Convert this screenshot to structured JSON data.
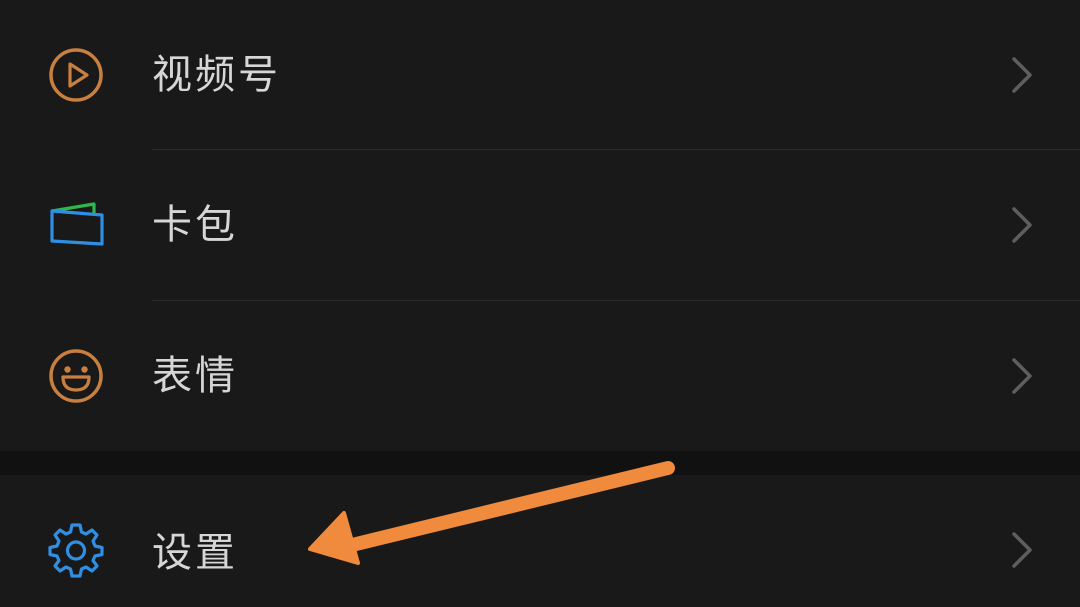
{
  "menu": {
    "items": [
      {
        "label": "视频号",
        "icon": "video-channel-icon",
        "icon_color": "#c97f3f"
      },
      {
        "label": "卡包",
        "icon": "card-wallet-icon",
        "icon_color": "#2f8fe3"
      },
      {
        "label": "表情",
        "icon": "emoji-smile-icon",
        "icon_color": "#c97f3f"
      },
      {
        "label": "设置",
        "icon": "settings-gear-icon",
        "icon_color": "#2f8fe3"
      }
    ]
  },
  "colors": {
    "background": "#191919",
    "text": "#d6d6d6",
    "chevron": "#5e5e5e",
    "annotation_arrow": "#f08a3c",
    "wallet_green": "#2fb84a"
  }
}
